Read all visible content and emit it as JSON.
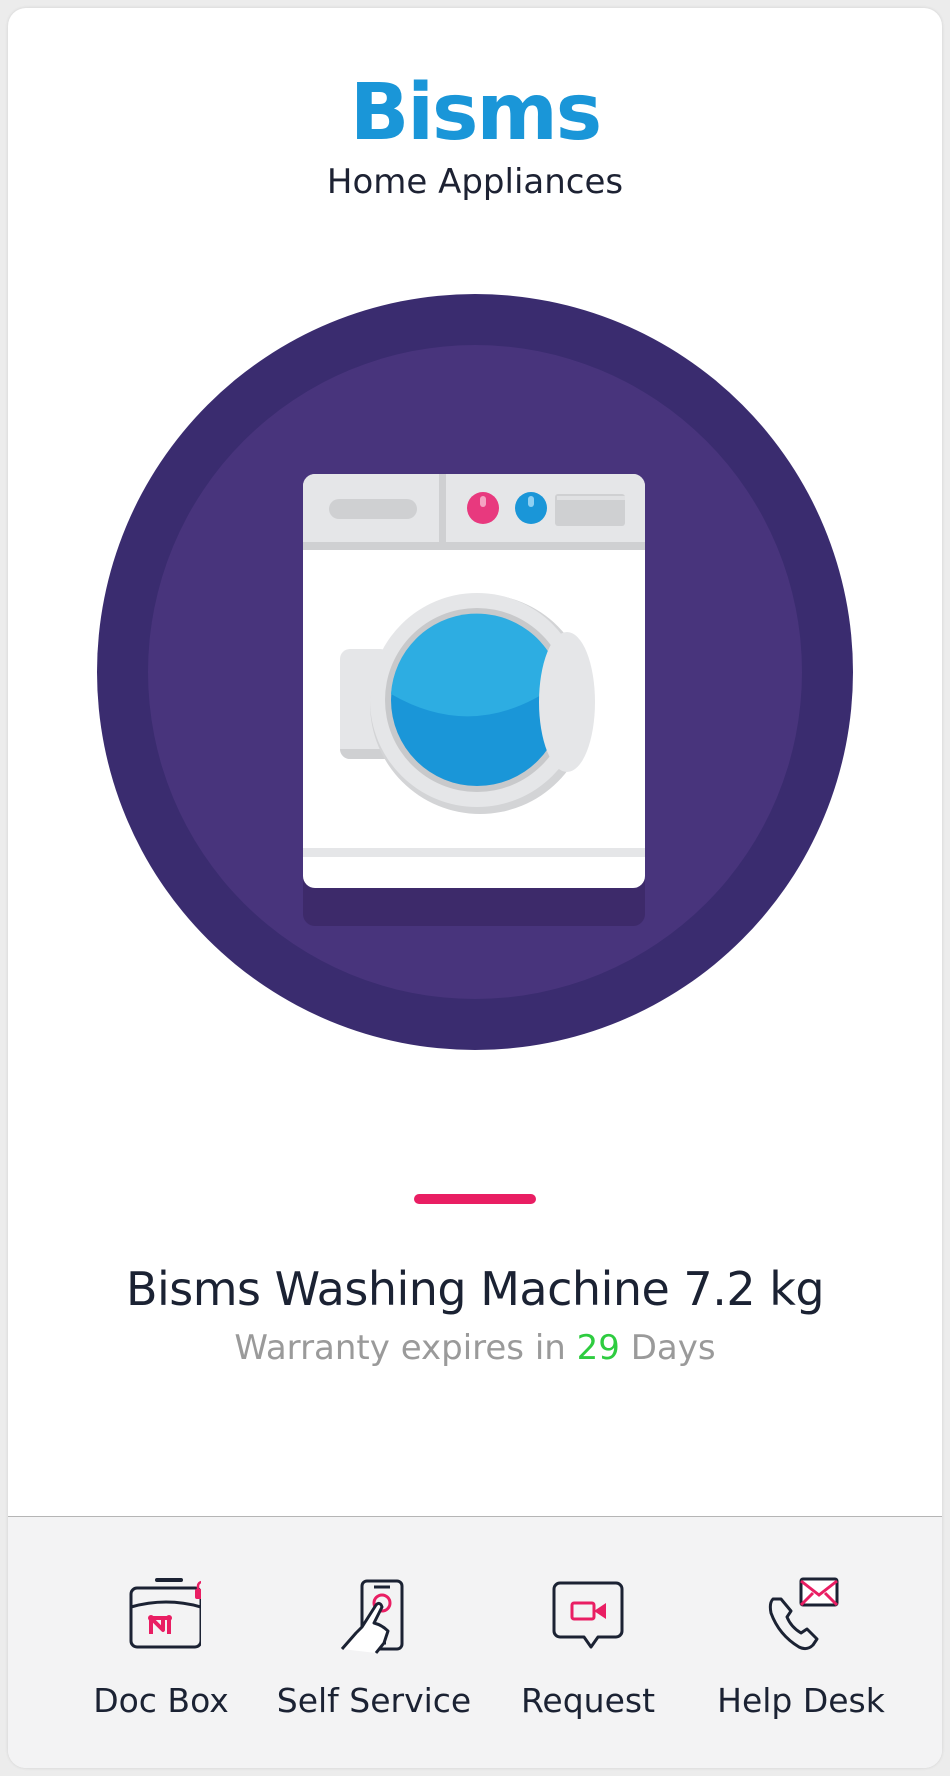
{
  "brand": {
    "name": "Bisms",
    "subtitle": "Home Appliances"
  },
  "product": {
    "image_icon": "washing-machine-icon",
    "name": "Bisms Washing Machine 7.2 kg",
    "warranty": {
      "prefix": "Warranty expires in",
      "days": "29",
      "suffix": "Days"
    }
  },
  "colors": {
    "brand_blue": "#1a96d8",
    "accent_pink": "#e91e63",
    "warranty_green": "#2ecc40",
    "circle_outer": "#3a2c6f",
    "circle_inner": "#48347c"
  },
  "bottom_nav": [
    {
      "label": "Doc Box",
      "icon": "doc-box-lock-icon"
    },
    {
      "label": "Self Service",
      "icon": "phone-touch-icon"
    },
    {
      "label": "Request",
      "icon": "video-chat-icon"
    },
    {
      "label": "Help Desk",
      "icon": "phone-mail-icon"
    }
  ]
}
